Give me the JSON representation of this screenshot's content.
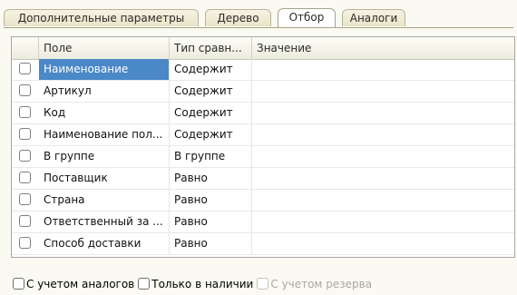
{
  "tabs": [
    {
      "label": "Дополнительные параметры",
      "active": false
    },
    {
      "label": "Дерево",
      "active": false
    },
    {
      "label": "Отбор",
      "active": true
    },
    {
      "label": "Аналоги",
      "active": false
    }
  ],
  "table": {
    "columns": [
      "Поле",
      "Тип сравн...",
      "Значение"
    ],
    "rows": [
      {
        "checked": false,
        "field": "Наименование",
        "comparison": "Содержит",
        "value": "",
        "selected": true
      },
      {
        "checked": false,
        "field": "Артикул",
        "comparison": "Содержит",
        "value": ""
      },
      {
        "checked": false,
        "field": "Код",
        "comparison": "Содержит",
        "value": ""
      },
      {
        "checked": false,
        "field": "Наименование пол...",
        "comparison": "Содержит",
        "value": ""
      },
      {
        "checked": false,
        "field": "В группе",
        "comparison": "В группе",
        "value": ""
      },
      {
        "checked": false,
        "field": "Поставщик",
        "comparison": "Равно",
        "value": ""
      },
      {
        "checked": false,
        "field": "Страна",
        "comparison": "Равно",
        "value": ""
      },
      {
        "checked": false,
        "field": "Ответственный за ...",
        "comparison": "Равно",
        "value": ""
      },
      {
        "checked": false,
        "field": "Способ доставки",
        "comparison": "Равно",
        "value": ""
      }
    ]
  },
  "options": [
    {
      "label": "С учетом аналогов",
      "checked": false,
      "enabled": true
    },
    {
      "label": "Только в наличии",
      "checked": false,
      "enabled": true
    },
    {
      "label": "С учетом резерва",
      "checked": false,
      "enabled": false
    }
  ],
  "colors": {
    "selection": "#4a88c7",
    "background": "#fbfaf2"
  }
}
